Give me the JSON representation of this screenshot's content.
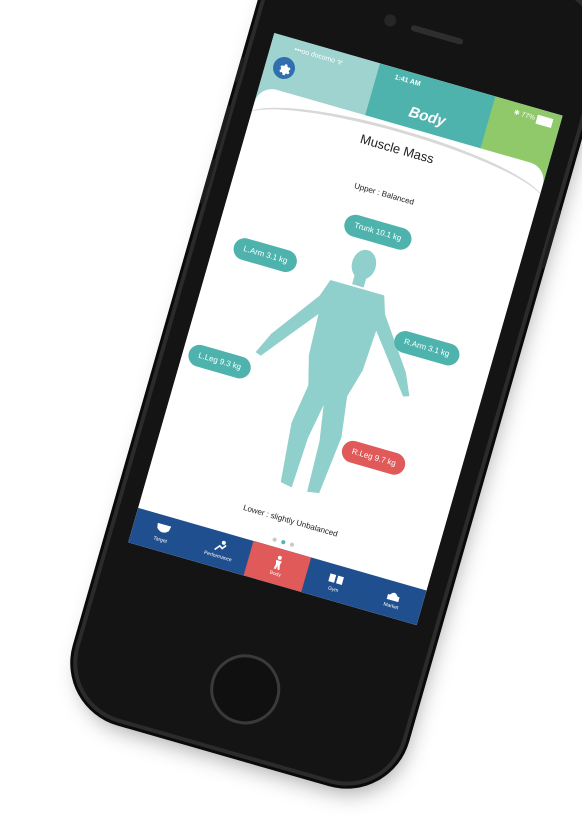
{
  "status": {
    "carrier": "•••oo docomo ᯤ",
    "time": "1:41 AM",
    "battery": "✱ 77%"
  },
  "header": {
    "title": "Body",
    "settings_icon": "gear-icon"
  },
  "card": {
    "title": "Muscle Mass",
    "upper_text": "Upper : Balanced",
    "lower_text": "Lower : slightly Unbalanced"
  },
  "segments": {
    "trunk": "Trunk 10.1 kg",
    "left_arm": "L.Arm 3.1 kg",
    "right_arm": "R.Arm 3.1 kg",
    "left_leg": "L.Leg 9.3 kg",
    "right_leg": "R.Leg 9.7 kg"
  },
  "tabs": [
    {
      "label": "Target",
      "icon": "target-icon"
    },
    {
      "label": "Performance",
      "icon": "performance-icon"
    },
    {
      "label": "Body",
      "icon": "body-icon",
      "active": true
    },
    {
      "label": "Gym",
      "icon": "gym-icon"
    },
    {
      "label": "Market",
      "icon": "market-icon"
    }
  ],
  "colors": {
    "teal": "#4fb3ad",
    "red": "#e05a5a",
    "navy": "#1f4f8f",
    "green": "#8fc96a"
  }
}
